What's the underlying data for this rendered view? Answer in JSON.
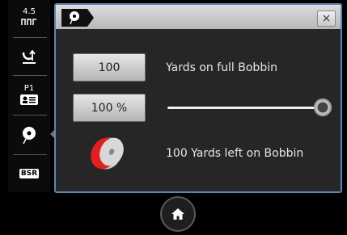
{
  "sidebar": {
    "items": [
      {
        "name": "stitch-length",
        "label": "4.5"
      },
      {
        "name": "thread-up"
      },
      {
        "name": "presser",
        "label": "P1"
      },
      {
        "name": "bobbin"
      },
      {
        "name": "bsr",
        "label": "BSR"
      }
    ]
  },
  "header": {
    "close_label": "×"
  },
  "bobbin": {
    "yards_value": "100",
    "yards_label": "Yards on full Bobbin",
    "percent_value": "100 %",
    "percent_level": 1.0,
    "remaining_label": "100 Yards left on Bobbin"
  },
  "colors": {
    "panel_border": "#5b87b6",
    "bobbin_red": "#e02020"
  },
  "icons": [
    "stitch-length-icon",
    "thread-up-icon",
    "presser-foot-icon",
    "bobbin-icon",
    "close-icon",
    "home-icon"
  ]
}
